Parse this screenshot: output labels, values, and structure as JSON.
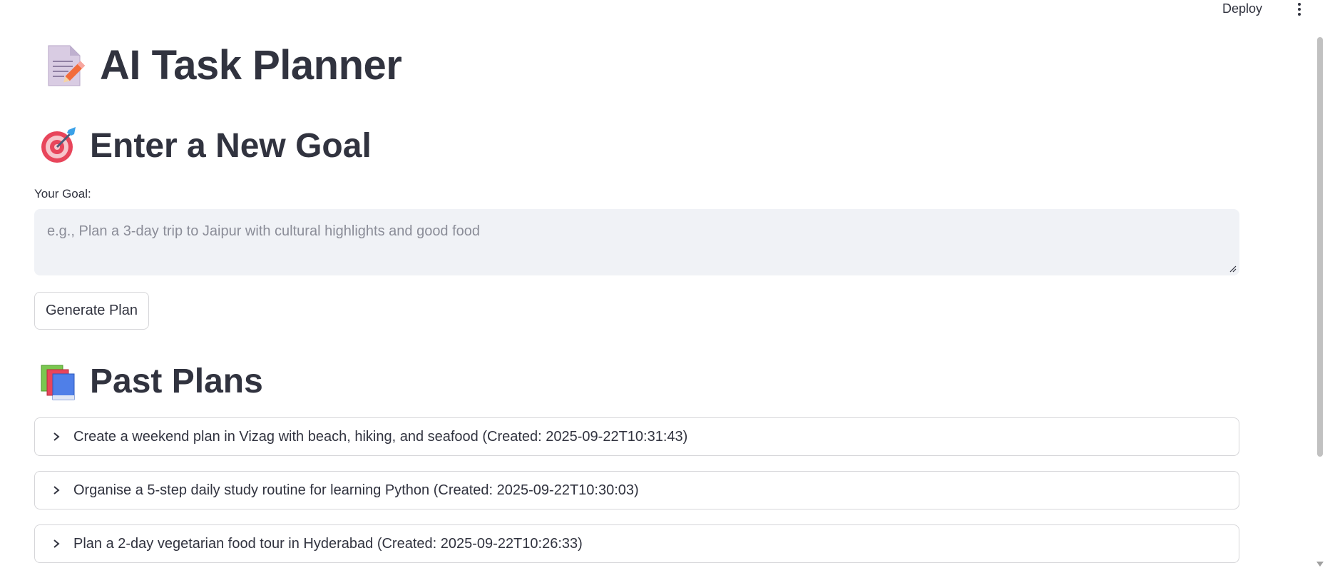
{
  "toolbar": {
    "deploy_label": "Deploy",
    "menu_icon": "kebab-menu-icon"
  },
  "page": {
    "title": "AI Task Planner",
    "title_icon": "memo-icon"
  },
  "goal_section": {
    "heading": "Enter a New Goal",
    "icon": "target-icon",
    "input_label": "Your Goal:",
    "input_value": "",
    "input_placeholder": "e.g., Plan a 3-day trip to Jaipur with cultural highlights and good food",
    "button_label": "Generate Plan"
  },
  "past_plans": {
    "heading": "Past Plans",
    "icon": "books-icon",
    "items": [
      {
        "label": "Create a weekend plan in Vizag with beach, hiking, and seafood (Created: 2025-09-22T10:31:43)"
      },
      {
        "label": "Organise a 5-step daily study routine for learning Python (Created: 2025-09-22T10:30:03)"
      },
      {
        "label": "Plan a 2-day vegetarian food tour in Hyderabad (Created: 2025-09-22T10:26:33)"
      }
    ]
  },
  "colors": {
    "text": "#31333f",
    "input_bg": "#f0f2f6",
    "border": "#d6d6d9",
    "placeholder": "#8b8d98"
  }
}
